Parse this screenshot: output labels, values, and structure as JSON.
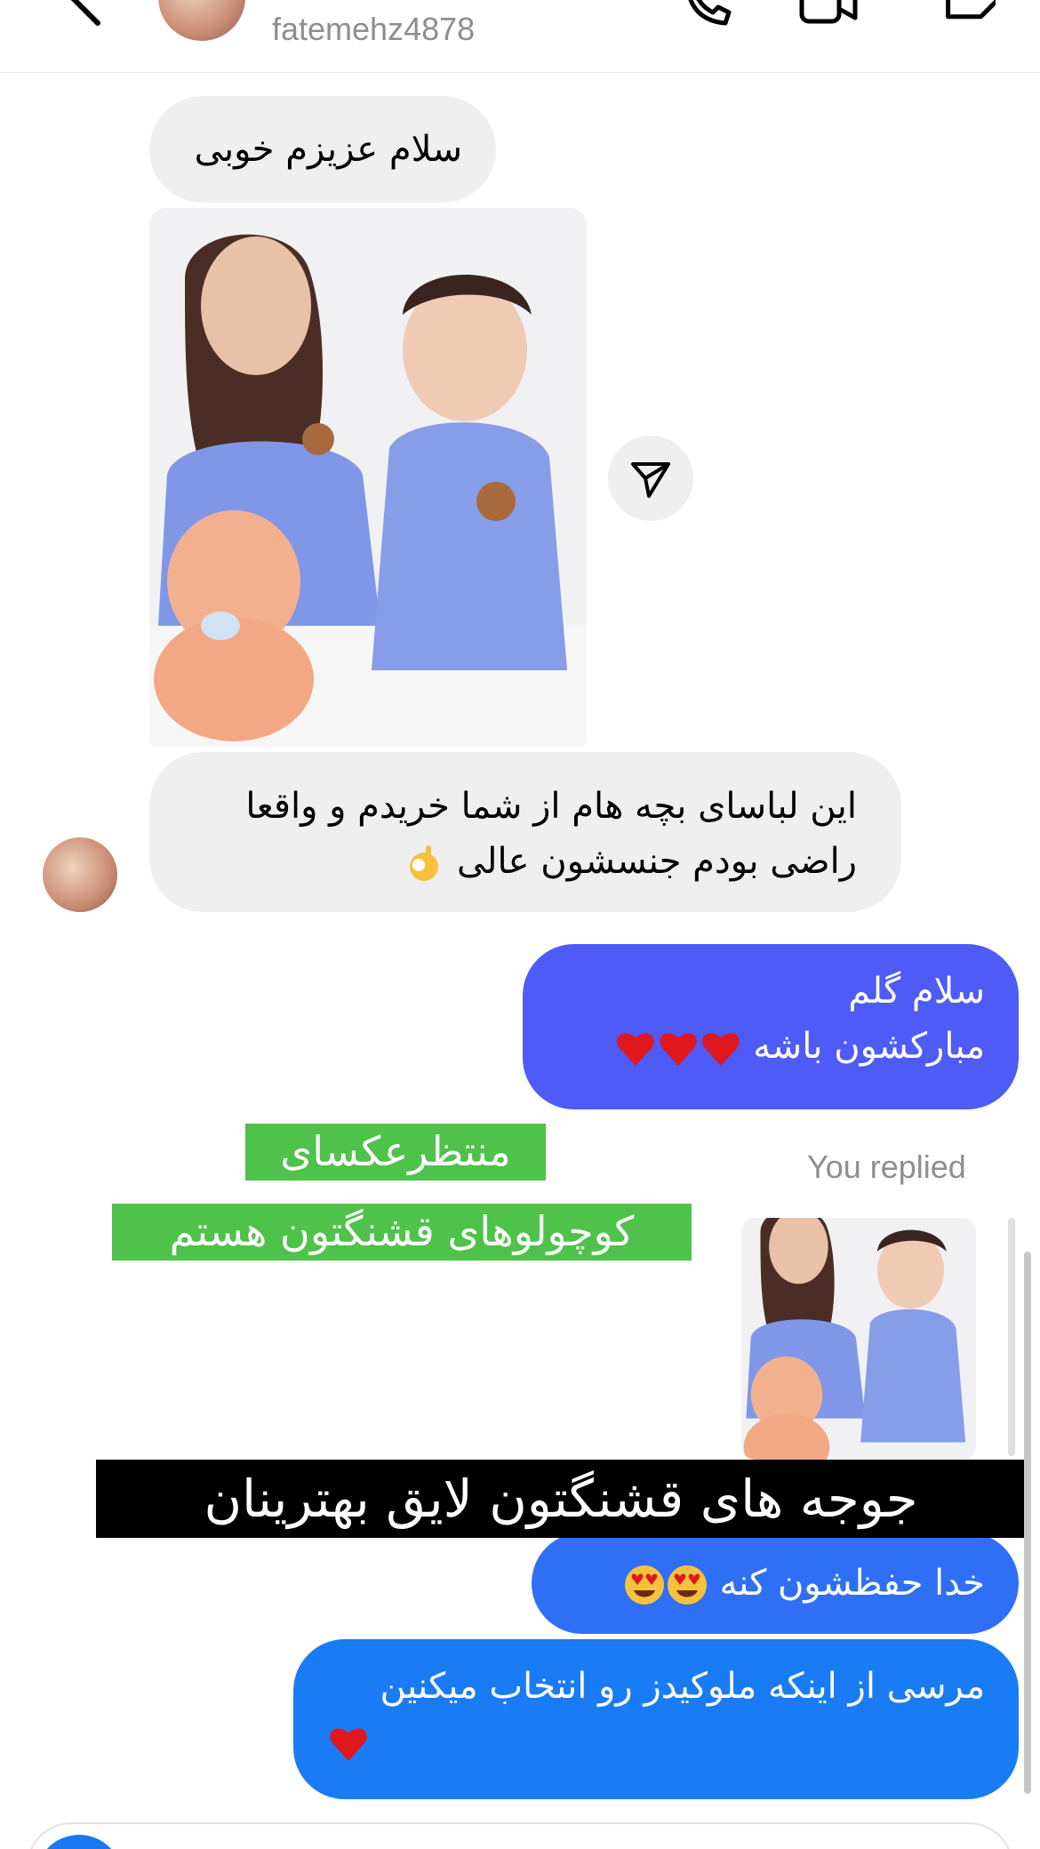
{
  "header": {
    "username": "fatemehz4878"
  },
  "messages": {
    "greeting": "سلام عزیزم خوبی",
    "review_line1": "این لباسای بچه هام از شما خریدم و واقعا",
    "review_line2": "راضی بودم جنسشون عالی",
    "reply1_line1": "سلام گلم",
    "reply1_line2": "مبارکشون باشه",
    "you_replied": "You replied",
    "reply2": "خدا حفظشون کنه",
    "reply3": "مرسی از اینکه ملوکیدز رو انتخاب میکنین"
  },
  "overlays": {
    "green_line1": "منتظرعکسای",
    "green_line2": "کوچولوهای قشنگتون هستم",
    "black_caption": "جوجه های قشنگتون لایق بهترینان"
  },
  "colors": {
    "sent_bubble_top": "#4e5bf6",
    "sent_bubble_bottom": "#1a7cf5",
    "received_bubble": "#efefef",
    "green_caption": "#4ec24a"
  },
  "icons": {
    "back": "chevron-left-icon",
    "call": "phone-icon",
    "video": "video-camera-icon",
    "tag": "tag-icon",
    "share": "paper-plane-icon",
    "camera": "camera-icon"
  }
}
